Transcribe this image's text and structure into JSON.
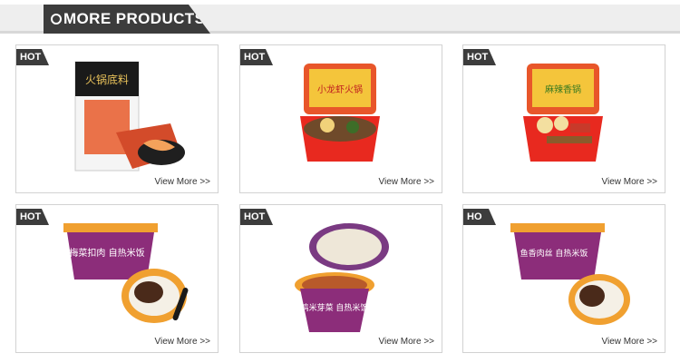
{
  "header": {
    "title": "MORE PRODUCTS",
    "bg_color": "#eeeeee",
    "tab_color": "#3c3c3c"
  },
  "products": [
    {
      "badge": "HOT",
      "link": "View More  >>",
      "image_icon": "bag-hotpot-base-image",
      "package_text": "火锅底料"
    },
    {
      "badge": "HOT",
      "link": "View More  >>",
      "image_icon": "self-heating-hotpot-box-image",
      "package_text": "小龙虾火锅"
    },
    {
      "badge": "HOT",
      "link": "View More  >>",
      "image_icon": "self-heating-hotpot-box-image",
      "package_text": "麻辣香锅"
    },
    {
      "badge": "HOT",
      "link": "View More  >>",
      "image_icon": "rice-bowl-image",
      "package_text": "梅菜扣肉 自热米饭"
    },
    {
      "badge": "HOT",
      "link": "View More  >>",
      "image_icon": "rice-bowl-image",
      "package_text": "鸡米芽菜 自热米饭"
    },
    {
      "badge": "HO",
      "link": "View More  >>",
      "image_icon": "rice-bowl-image",
      "package_text": "鱼香肉丝 自热米饭"
    }
  ]
}
